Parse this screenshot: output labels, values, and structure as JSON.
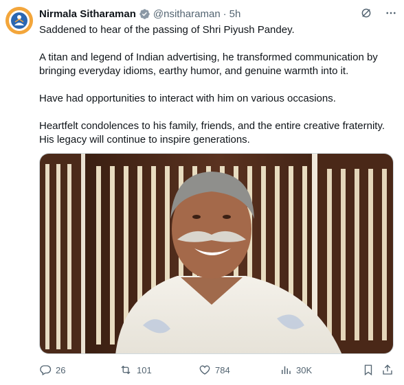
{
  "author": {
    "name": "Nirmala Sitharaman",
    "handle": "@nsitharaman",
    "separator": "·",
    "time": "5h"
  },
  "tweet": {
    "paragraphs": [
      "Saddened to hear of the passing of Shri Piyush Pandey.",
      "A titan and legend of Indian advertising, he transformed communication by bringing everyday idioms, earthy humor, and genuine warmth into it.",
      "Have had opportunities to interact with him on various occasions.",
      "Heartfelt condolences to his family, friends, and the entire creative fraternity. His legacy will continue to inspire generations."
    ]
  },
  "icons": {
    "avatar": "emblem-avatar",
    "verified": "verified-badge-icon",
    "grok": "grok-icon",
    "more": "more-icon",
    "reply": "reply-icon",
    "repost": "repost-icon",
    "like": "like-icon",
    "views": "views-icon",
    "bookmark": "bookmark-icon",
    "share": "share-icon"
  },
  "metrics": {
    "replies": "26",
    "reposts": "101",
    "likes": "784",
    "views": "30K"
  },
  "colors": {
    "text": "#0f1419",
    "secondary": "#536471",
    "verified_gold": "#e8a325",
    "border": "#cfd9de"
  }
}
